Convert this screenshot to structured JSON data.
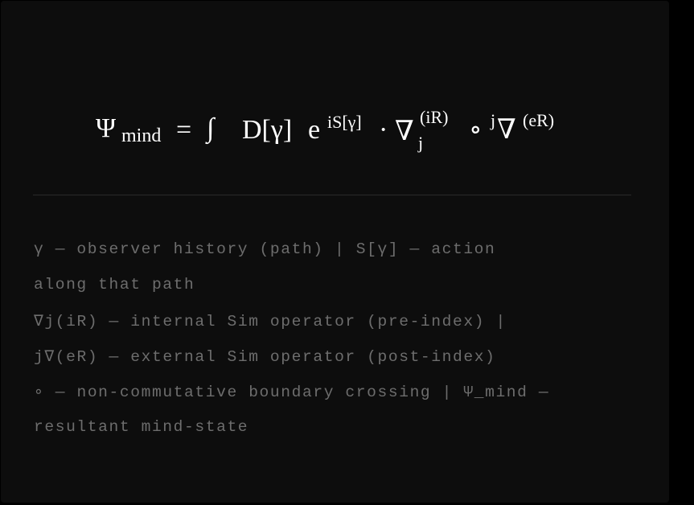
{
  "equation": {
    "psi": "Ψ",
    "psi_sub": "mind",
    "equals": "=",
    "integral": "∫",
    "measure": "D[γ]",
    "exp_base": "e",
    "exp_sup": "iS[γ]",
    "dot": "·",
    "nabla_internal": "∇",
    "internal_sub": "j",
    "internal_sup": "(iR)",
    "compose": "∘",
    "external_pre": "j",
    "nabla_external": "∇",
    "external_sup": "(eR)"
  },
  "legend": {
    "lines": [
      "γ — observer history (path)  |  S[γ] — action",
      "along that path",
      "∇j(iR) — internal Sim operator (pre-index)  |",
      "j∇(eR) — external Sim operator (post-index)",
      "∘ — non-commutative boundary crossing  |  Ψ_mind —",
      "resultant mind-state"
    ]
  },
  "colors": {
    "background": "#0d0d0d",
    "equation_text": "#ffffff",
    "legend_text": "#6d6d6d",
    "divider": "#2a2a2a"
  }
}
